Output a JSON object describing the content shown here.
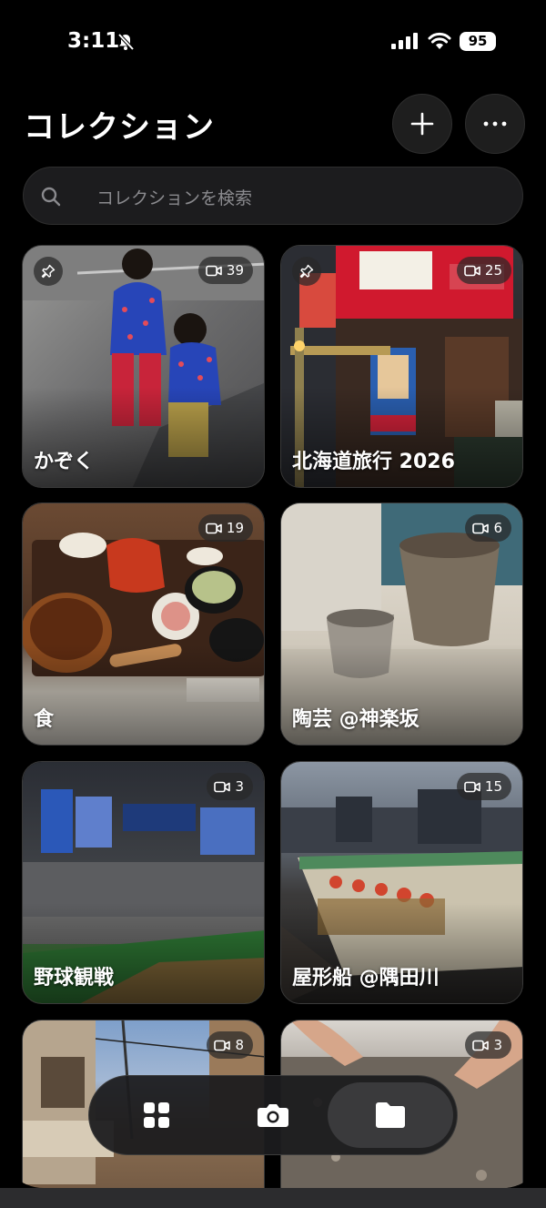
{
  "status_bar": {
    "time": "3:11",
    "battery": "95"
  },
  "header": {
    "title": "コレクション"
  },
  "search": {
    "placeholder": "コレクションを検索"
  },
  "collections": [
    {
      "label": "かぞく",
      "count": "39",
      "pinned": true
    },
    {
      "label": "北海道旅行 2026",
      "count": "25",
      "pinned": true
    },
    {
      "label": "食",
      "count": "19",
      "pinned": false
    },
    {
      "label": "陶芸 @神楽坂",
      "count": "6",
      "pinned": false
    },
    {
      "label": "野球観戦",
      "count": "3",
      "pinned": false
    },
    {
      "label": "屋形船 @隅田川",
      "count": "15",
      "pinned": false
    },
    {
      "label": "",
      "count": "8",
      "pinned": false
    },
    {
      "label": "",
      "count": "3",
      "pinned": false
    }
  ],
  "tabbar": {
    "tabs": [
      "grid-icon",
      "camera-icon",
      "folder-icon"
    ],
    "active": "folder-icon"
  },
  "colors": {
    "background": "#000000",
    "surface": "#1c1c1e",
    "active_tab": "#3a3a3c"
  }
}
